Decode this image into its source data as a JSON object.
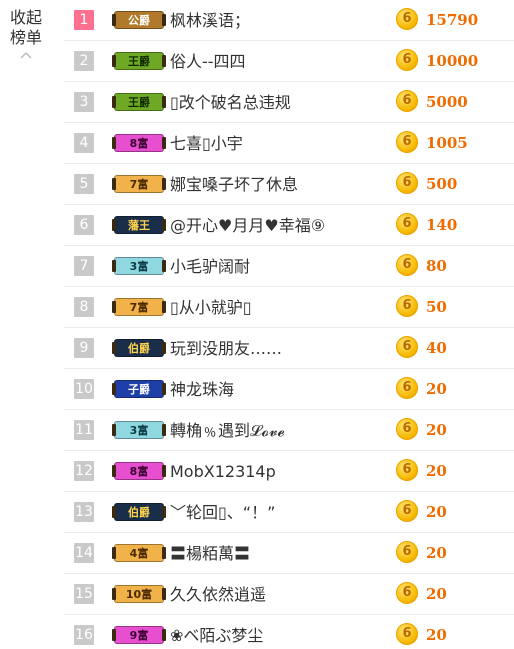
{
  "panel": {
    "collapse_label": "收起榜单"
  },
  "colors": {
    "accent": "#f06b00",
    "first_rank": "#ff6f8f",
    "rank_bg": "#c9c9c9",
    "coin": "#f7b800"
  },
  "rows": [
    {
      "rank": "1",
      "badge": "公爵",
      "name": "枫林溪语；",
      "amount": "15790"
    },
    {
      "rank": "2",
      "badge": "王爵",
      "name": "俗人--四四",
      "amount": "10000"
    },
    {
      "rank": "3",
      "badge": "王爵",
      "name": "▯改个破名总违规",
      "amount": "5000"
    },
    {
      "rank": "4",
      "badge": "8富",
      "name": "七喜▯小宇",
      "amount": "1005"
    },
    {
      "rank": "5",
      "badge": "7富",
      "name": "娜宝嗓子坏了休息",
      "amount": "500"
    },
    {
      "rank": "6",
      "badge": "藩王",
      "name": "@开心♥月月♥幸福⑨",
      "amount": "140"
    },
    {
      "rank": "7",
      "badge": "3富",
      "name": "小毛驴阔耐",
      "amount": "80"
    },
    {
      "rank": "8",
      "badge": "7富",
      "name": "▯从小就驴▯",
      "amount": "50"
    },
    {
      "rank": "9",
      "badge": "伯爵",
      "name": "玩到没朋友……",
      "amount": "40"
    },
    {
      "rank": "10",
      "badge": "子爵",
      "name": "神龙珠海",
      "amount": "20"
    },
    {
      "rank": "11",
      "badge": "3富",
      "name": "轉桷﹪遇到𝓛𝓸𝓿𝓮",
      "amount": "20"
    },
    {
      "rank": "12",
      "badge": "8富",
      "name": "MobX12314p",
      "amount": "20"
    },
    {
      "rank": "13",
      "badge": "伯爵",
      "name": "﹀轮回▯、“！”",
      "amount": "20"
    },
    {
      "rank": "14",
      "badge": "4富",
      "name": "〓楊粨萬〓",
      "amount": "20"
    },
    {
      "rank": "15",
      "badge": "10富",
      "name": "久久依然逍遥",
      "amount": "20"
    },
    {
      "rank": "16",
      "badge": "9富",
      "name": "❀ベ陌ぶ梦尘",
      "amount": "20"
    }
  ]
}
